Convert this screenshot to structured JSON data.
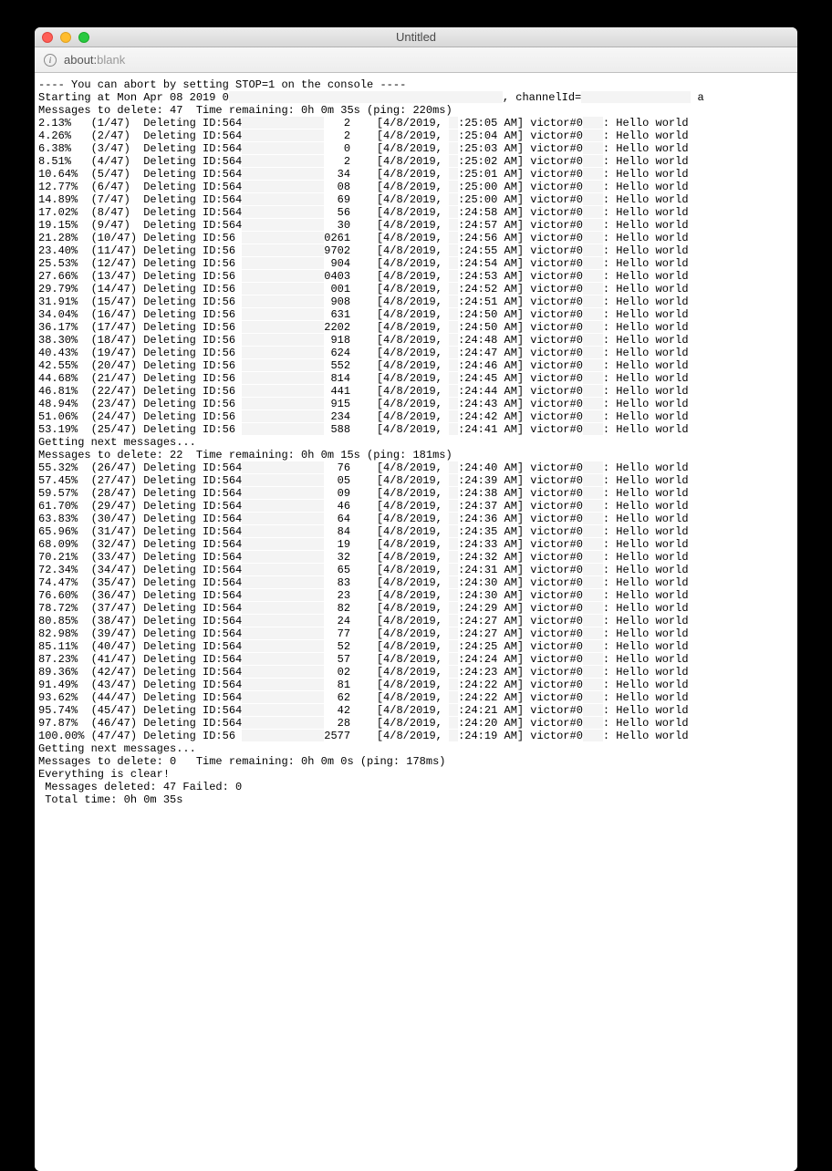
{
  "window_title": "Untitled",
  "url_scheme": "about:",
  "url_path": "blank",
  "header_abort": "---- You can abort by setting STOP=1 on the console ----",
  "header_start": "Starting at Mon Apr 08 2019 0",
  "header_channel": ", channelId=",
  "header_msgs1": "Messages to delete: 47  Time remaining: 0h 0m 35s (ping: 220ms)",
  "rows1": [
    {
      "pct": "2.13%",
      "cnt": "(1/47)",
      "id": "564",
      "suf": "2",
      "date": "[4/8/2019,",
      "time": ":25:05 AM]",
      "msg": ": Hello world"
    },
    {
      "pct": "4.26%",
      "cnt": "(2/47)",
      "id": "564",
      "suf": "2",
      "date": "[4/8/2019,",
      "time": ":25:04 AM]",
      "msg": ": Hello world"
    },
    {
      "pct": "6.38%",
      "cnt": "(3/47)",
      "id": "564",
      "suf": "0",
      "date": "[4/8/2019,",
      "time": ":25:03 AM]",
      "msg": ": Hello world"
    },
    {
      "pct": "8.51%",
      "cnt": "(4/47)",
      "id": "564",
      "suf": "2",
      "date": "[4/8/2019,",
      "time": ":25:02 AM]",
      "msg": ": Hello world"
    },
    {
      "pct": "10.64%",
      "cnt": "(5/47)",
      "id": "564",
      "suf": "34",
      "date": "[4/8/2019,",
      "time": ":25:01 AM]",
      "msg": ": Hello world"
    },
    {
      "pct": "12.77%",
      "cnt": "(6/47)",
      "id": "564",
      "suf": "08",
      "date": "[4/8/2019,",
      "time": ":25:00 AM]",
      "msg": ": Hello world"
    },
    {
      "pct": "14.89%",
      "cnt": "(7/47)",
      "id": "564",
      "suf": "69",
      "date": "[4/8/2019,",
      "time": ":25:00 AM]",
      "msg": ": Hello world"
    },
    {
      "pct": "17.02%",
      "cnt": "(8/47)",
      "id": "564",
      "suf": "56",
      "date": "[4/8/2019,",
      "time": ":24:58 AM]",
      "msg": ": Hello world"
    },
    {
      "pct": "19.15%",
      "cnt": "(9/47)",
      "id": "564",
      "suf": "30",
      "date": "[4/8/2019,",
      "time": ":24:57 AM]",
      "msg": ": Hello world"
    },
    {
      "pct": "21.28%",
      "cnt": "(10/47)",
      "id": "56",
      "suf": "0261",
      "date": "[4/8/2019,",
      "time": ":24:56 AM]",
      "msg": ": Hello world"
    },
    {
      "pct": "23.40%",
      "cnt": "(11/47)",
      "id": "56",
      "suf": "9702",
      "date": "[4/8/2019,",
      "time": ":24:55 AM]",
      "msg": ": Hello world"
    },
    {
      "pct": "25.53%",
      "cnt": "(12/47)",
      "id": "56",
      "suf": "904",
      "date": "[4/8/2019,",
      "time": ":24:54 AM]",
      "msg": ": Hello world"
    },
    {
      "pct": "27.66%",
      "cnt": "(13/47)",
      "id": "56",
      "suf": "0403",
      "date": "[4/8/2019,",
      "time": ":24:53 AM]",
      "msg": ": Hello world"
    },
    {
      "pct": "29.79%",
      "cnt": "(14/47)",
      "id": "56",
      "suf": "001",
      "date": "[4/8/2019,",
      "time": ":24:52 AM]",
      "msg": ": Hello world"
    },
    {
      "pct": "31.91%",
      "cnt": "(15/47)",
      "id": "56",
      "suf": "908",
      "date": "[4/8/2019,",
      "time": ":24:51 AM]",
      "msg": ": Hello world"
    },
    {
      "pct": "34.04%",
      "cnt": "(16/47)",
      "id": "56",
      "suf": "631",
      "date": "[4/8/2019,",
      "time": ":24:50 AM]",
      "msg": ": Hello world"
    },
    {
      "pct": "36.17%",
      "cnt": "(17/47)",
      "id": "56",
      "suf": "2202",
      "date": "[4/8/2019,",
      "time": ":24:50 AM]",
      "msg": ": Hello world"
    },
    {
      "pct": "38.30%",
      "cnt": "(18/47)",
      "id": "56",
      "suf": "918",
      "date": "[4/8/2019,",
      "time": ":24:48 AM]",
      "msg": ": Hello world"
    },
    {
      "pct": "40.43%",
      "cnt": "(19/47)",
      "id": "56",
      "suf": "624",
      "date": "[4/8/2019,",
      "time": ":24:47 AM]",
      "msg": ": Hello world"
    },
    {
      "pct": "42.55%",
      "cnt": "(20/47)",
      "id": "56",
      "suf": "552",
      "date": "[4/8/2019,",
      "time": ":24:46 AM]",
      "msg": ": Hello world"
    },
    {
      "pct": "44.68%",
      "cnt": "(21/47)",
      "id": "56",
      "suf": "814",
      "date": "[4/8/2019,",
      "time": ":24:45 AM]",
      "msg": ": Hello world"
    },
    {
      "pct": "46.81%",
      "cnt": "(22/47)",
      "id": "56",
      "suf": "441",
      "date": "[4/8/2019,",
      "time": ":24:44 AM]",
      "msg": ": Hello world"
    },
    {
      "pct": "48.94%",
      "cnt": "(23/47)",
      "id": "56",
      "suf": "915",
      "date": "[4/8/2019,",
      "time": ":24:43 AM]",
      "msg": ": Hello world"
    },
    {
      "pct": "51.06%",
      "cnt": "(24/47)",
      "id": "56",
      "suf": "234",
      "date": "[4/8/2019,",
      "time": ":24:42 AM]",
      "msg": ": Hello world"
    },
    {
      "pct": "53.19%",
      "cnt": "(25/47)",
      "id": "56",
      "suf": "588",
      "date": "[4/8/2019,",
      "time": ":24:41 AM]",
      "msg": ": Hello world"
    }
  ],
  "getting1": "Getting next messages...",
  "header_msgs2": "Messages to delete: 22  Time remaining: 0h 0m 15s (ping: 181ms)",
  "rows2": [
    {
      "pct": "55.32%",
      "cnt": "(26/47)",
      "id": "564",
      "suf": "76",
      "date": "[4/8/2019,",
      "time": ":24:40 AM]",
      "msg": ": Hello world"
    },
    {
      "pct": "57.45%",
      "cnt": "(27/47)",
      "id": "564",
      "suf": "05",
      "date": "[4/8/2019,",
      "time": ":24:39 AM]",
      "msg": ": Hello world"
    },
    {
      "pct": "59.57%",
      "cnt": "(28/47)",
      "id": "564",
      "suf": "09",
      "date": "[4/8/2019,",
      "time": ":24:38 AM]",
      "msg": ": Hello world"
    },
    {
      "pct": "61.70%",
      "cnt": "(29/47)",
      "id": "564",
      "suf": "46",
      "date": "[4/8/2019,",
      "time": ":24:37 AM]",
      "msg": ": Hello world"
    },
    {
      "pct": "63.83%",
      "cnt": "(30/47)",
      "id": "564",
      "suf": "64",
      "date": "[4/8/2019,",
      "time": ":24:36 AM]",
      "msg": ": Hello world"
    },
    {
      "pct": "65.96%",
      "cnt": "(31/47)",
      "id": "564",
      "suf": "84",
      "date": "[4/8/2019,",
      "time": ":24:35 AM]",
      "msg": ": Hello world"
    },
    {
      "pct": "68.09%",
      "cnt": "(32/47)",
      "id": "564",
      "suf": "19",
      "date": "[4/8/2019,",
      "time": ":24:33 AM]",
      "msg": ": Hello world"
    },
    {
      "pct": "70.21%",
      "cnt": "(33/47)",
      "id": "564",
      "suf": "32",
      "date": "[4/8/2019,",
      "time": ":24:32 AM]",
      "msg": ": Hello world"
    },
    {
      "pct": "72.34%",
      "cnt": "(34/47)",
      "id": "564",
      "suf": "65",
      "date": "[4/8/2019,",
      "time": ":24:31 AM]",
      "msg": ": Hello world"
    },
    {
      "pct": "74.47%",
      "cnt": "(35/47)",
      "id": "564",
      "suf": "83",
      "date": "[4/8/2019,",
      "time": ":24:30 AM]",
      "msg": ": Hello world"
    },
    {
      "pct": "76.60%",
      "cnt": "(36/47)",
      "id": "564",
      "suf": "23",
      "date": "[4/8/2019,",
      "time": ":24:30 AM]",
      "msg": ": Hello world"
    },
    {
      "pct": "78.72%",
      "cnt": "(37/47)",
      "id": "564",
      "suf": "82",
      "date": "[4/8/2019,",
      "time": ":24:29 AM]",
      "msg": ": Hello world"
    },
    {
      "pct": "80.85%",
      "cnt": "(38/47)",
      "id": "564",
      "suf": "24",
      "date": "[4/8/2019,",
      "time": ":24:27 AM]",
      "msg": ": Hello world"
    },
    {
      "pct": "82.98%",
      "cnt": "(39/47)",
      "id": "564",
      "suf": "77",
      "date": "[4/8/2019,",
      "time": ":24:27 AM]",
      "msg": ": Hello world"
    },
    {
      "pct": "85.11%",
      "cnt": "(40/47)",
      "id": "564",
      "suf": "52",
      "date": "[4/8/2019,",
      "time": ":24:25 AM]",
      "msg": ": Hello world"
    },
    {
      "pct": "87.23%",
      "cnt": "(41/47)",
      "id": "564",
      "suf": "57",
      "date": "[4/8/2019,",
      "time": ":24:24 AM]",
      "msg": ": Hello world"
    },
    {
      "pct": "89.36%",
      "cnt": "(42/47)",
      "id": "564",
      "suf": "02",
      "date": "[4/8/2019,",
      "time": ":24:23 AM]",
      "msg": ": Hello world"
    },
    {
      "pct": "91.49%",
      "cnt": "(43/47)",
      "id": "564",
      "suf": "81",
      "date": "[4/8/2019,",
      "time": ":24:22 AM]",
      "msg": ": Hello world"
    },
    {
      "pct": "93.62%",
      "cnt": "(44/47)",
      "id": "564",
      "suf": "62",
      "date": "[4/8/2019,",
      "time": ":24:22 AM]",
      "msg": ": Hello world"
    },
    {
      "pct": "95.74%",
      "cnt": "(45/47)",
      "id": "564",
      "suf": "42",
      "date": "[4/8/2019,",
      "time": ":24:21 AM]",
      "msg": ": Hello world"
    },
    {
      "pct": "97.87%",
      "cnt": "(46/47)",
      "id": "564",
      "suf": "28",
      "date": "[4/8/2019,",
      "time": ":24:20 AM]",
      "msg": ": Hello world"
    },
    {
      "pct": "100.00%",
      "cnt": "(47/47)",
      "id": "56",
      "suf": "2577",
      "date": "[4/8/2019,",
      "time": ":24:19 AM]",
      "msg": ": Hello world"
    }
  ],
  "getting2": "Getting next messages...",
  "header_msgs3": "Messages to delete: 0   Time remaining: 0h 0m 0s (ping: 178ms)",
  "footer_clear": "Everything is clear!",
  "footer_deleted": " Messages deleted: 47 Failed: 0",
  "footer_total": " Total time: 0h 0m 35s",
  "deleting_label": "Deleting",
  "user_label": "victor#0"
}
